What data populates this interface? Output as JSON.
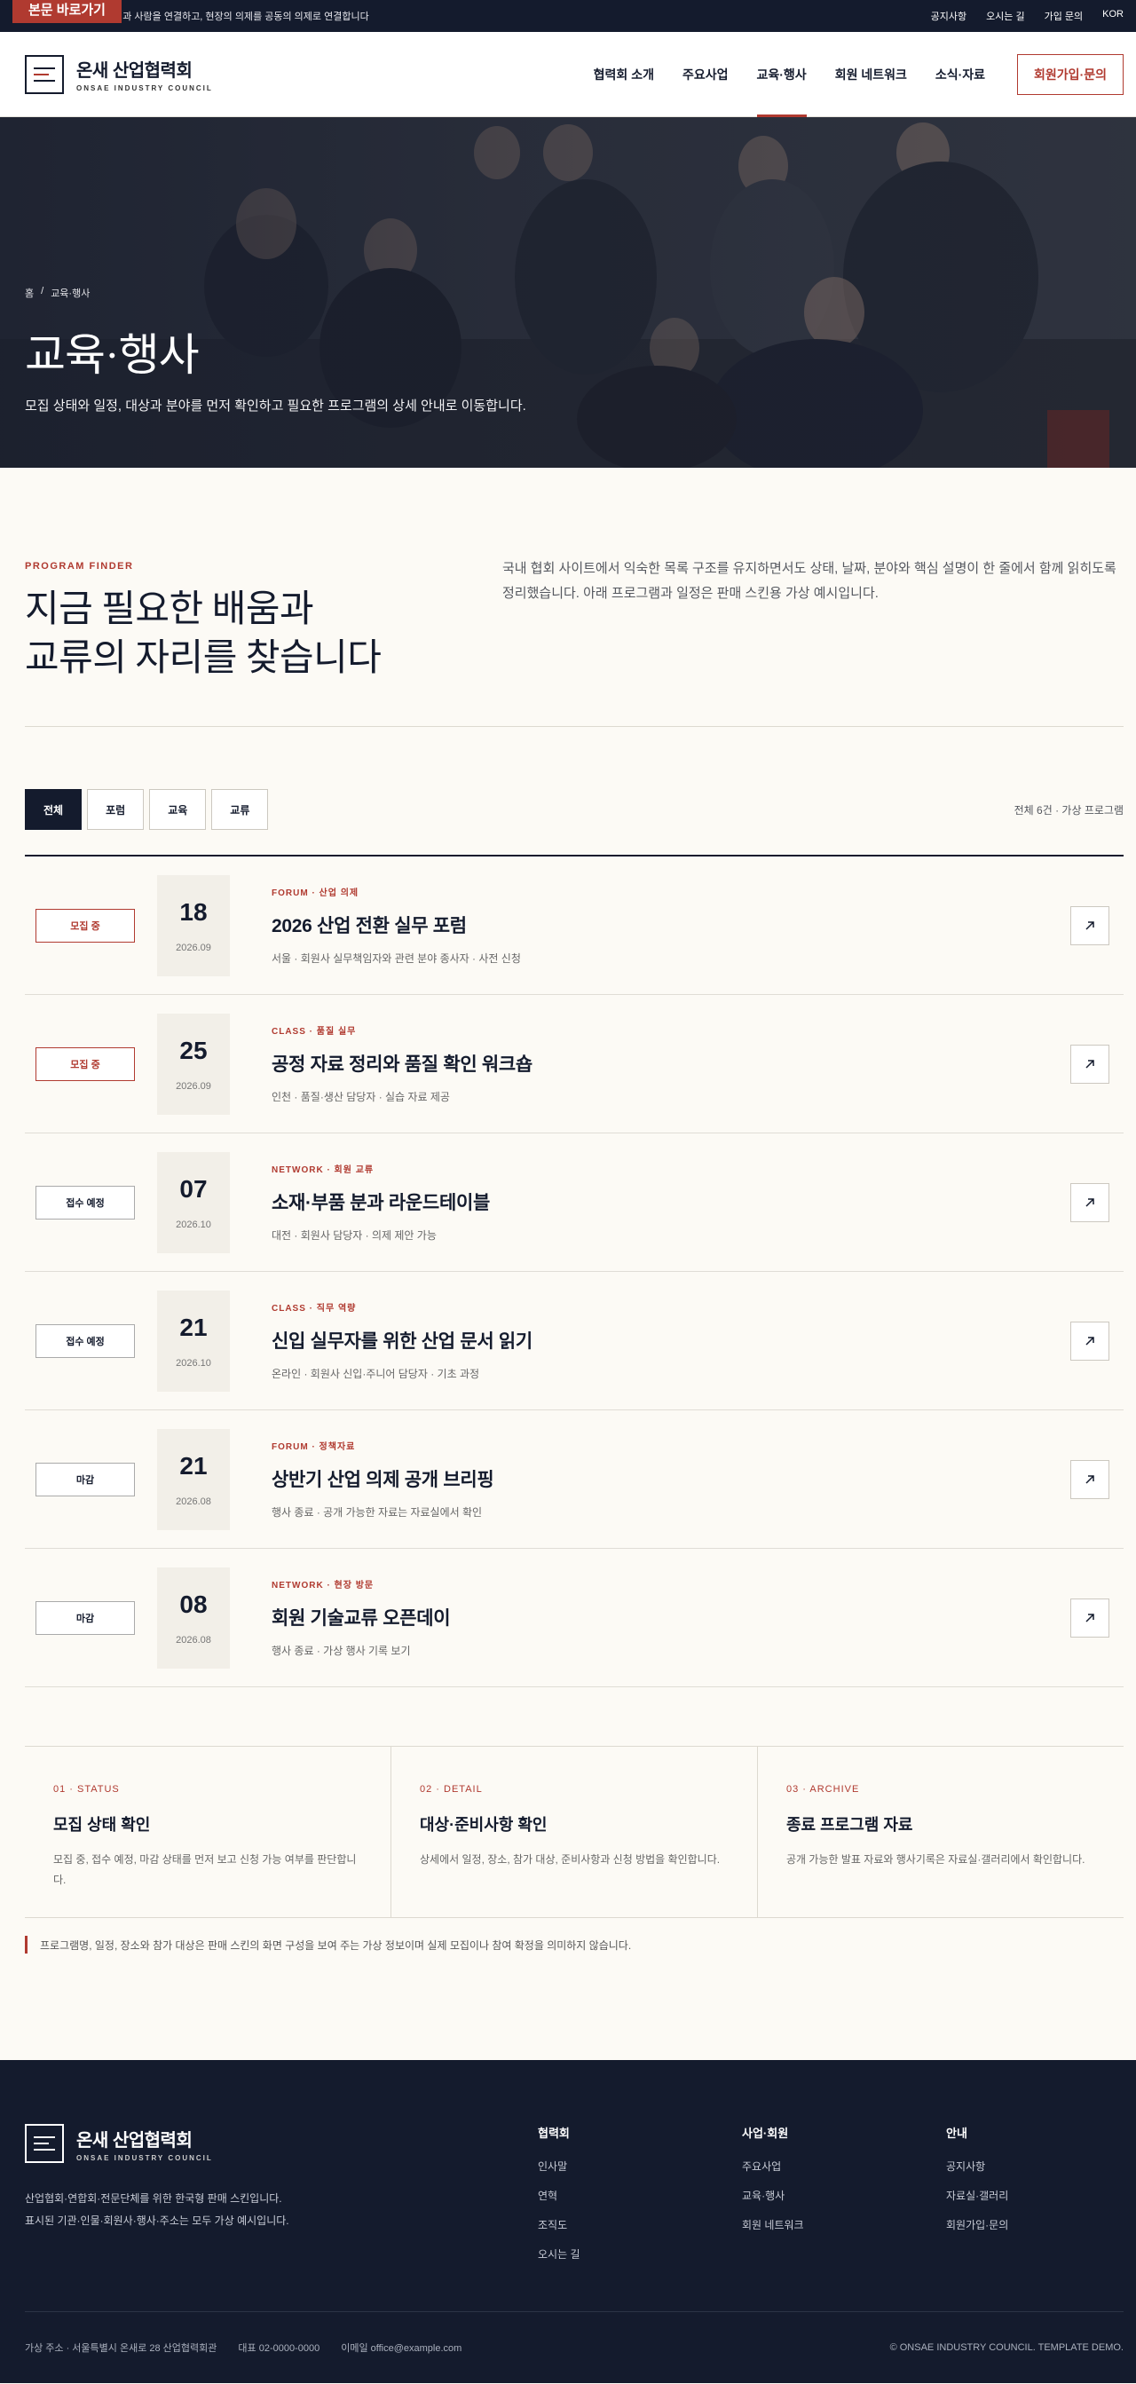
{
  "topbar": {
    "skip_label": "본문 바로가기",
    "tagline": "산업과 사람을 연결하고, 현장의 의제를 공동의 의제로 연결합니다",
    "util": [
      "공지사항",
      "오시는 길",
      "가입 문의",
      "KOR"
    ]
  },
  "header": {
    "logo_ko": "온새 산업협력회",
    "logo_en": "ONSAE INDUSTRY COUNCIL",
    "nav": [
      "협력회 소개",
      "주요사업",
      "교육·행사",
      "회원 네트워크",
      "소식·자료"
    ],
    "active_nav": "교육·행사",
    "cta": "회원가입·문의"
  },
  "hero": {
    "breadcrumb": [
      "홈",
      "/",
      "교육·행사"
    ],
    "title": "교육·행사",
    "subtitle": "모집 상태와 일정, 대상과 분야를 먼저 확인하고 필요한 프로그램의 상세 안내로 이동합니다."
  },
  "intro": {
    "eyebrow": "PROGRAM FINDER",
    "title_line1": "지금 필요한 배움과",
    "title_line2": "교류의 자리를 찾습니다",
    "desc": "국내 협회 사이트에서 익숙한 목록 구조를 유지하면서도 상태, 날짜, 분야와 핵심 설명이 한 줄에서 함께 읽히도록 정리했습니다. 아래 프로그램과 일정은 판매 스킨용 가상 예시입니다."
  },
  "filters": {
    "tabs": [
      "전체",
      "포럼",
      "교육",
      "교류"
    ],
    "active": "전체",
    "count": "전체 6건 · 가상 프로그램"
  },
  "programs": [
    {
      "status": "모집 중",
      "status_type": "open",
      "day": "18",
      "ym": "2026.09",
      "cat": "FORUM · 산업 의제",
      "title": "2026 산업 전환 실무 포럼",
      "meta": "서울 · 회원사 실무책임자와 관련 분야 종사자 · 사전 신청"
    },
    {
      "status": "모집 중",
      "status_type": "open",
      "day": "25",
      "ym": "2026.09",
      "cat": "CLASS · 품질 실무",
      "title": "공정 자료 정리와 품질 확인 워크숍",
      "meta": "인천 · 품질·생산 담당자 · 실습 자료 제공"
    },
    {
      "status": "접수 예정",
      "status_type": "soon",
      "day": "07",
      "ym": "2026.10",
      "cat": "NETWORK · 회원 교류",
      "title": "소재·부품 분과 라운드테이블",
      "meta": "대전 · 회원사 담당자 · 의제 제안 가능"
    },
    {
      "status": "접수 예정",
      "status_type": "soon",
      "day": "21",
      "ym": "2026.10",
      "cat": "CLASS · 직무 역량",
      "title": "신입 실무자를 위한 산업 문서 읽기",
      "meta": "온라인 · 회원사 신입·주니어 담당자 · 기초 과정"
    },
    {
      "status": "마감",
      "status_type": "closed",
      "day": "21",
      "ym": "2026.08",
      "cat": "FORUM · 정책자료",
      "title": "상반기 산업 의제 공개 브리핑",
      "meta": "행사 종료 · 공개 가능한 자료는 자료실에서 확인"
    },
    {
      "status": "마감",
      "status_type": "closed",
      "day": "08",
      "ym": "2026.08",
      "cat": "NETWORK · 현장 방문",
      "title": "회원 기술교류 오픈데이",
      "meta": "행사 종료 · 가상 행사 기록 보기"
    }
  ],
  "guide": [
    {
      "num": "01 · STATUS",
      "title": "모집 상태 확인",
      "desc": "모집 중, 접수 예정, 마감 상태를 먼저 보고 신청 가능 여부를 판단합니다."
    },
    {
      "num": "02 · DETAIL",
      "title": "대상·준비사항 확인",
      "desc": "상세에서 일정, 장소, 참가 대상, 준비사항과 신청 방법을 확인합니다."
    },
    {
      "num": "03 · ARCHIVE",
      "title": "종료 프로그램 자료",
      "desc": "공개 가능한 발표 자료와 행사기록은 자료실·갤러리에서 확인합니다."
    }
  ],
  "notice": "프로그램명, 일정, 장소와 참가 대상은 판매 스킨의 화면 구성을 보여 주는 가상 정보이며 실제 모집이나 참여 확정을 의미하지 않습니다.",
  "footer": {
    "logo_ko": "온새 산업협력회",
    "logo_en": "ONSAE INDUSTRY COUNCIL",
    "desc_line1": "산업협회·연합회·전문단체를 위한 한국형 판매 스킨입니다.",
    "desc_line2": "표시된 기관·인물·회원사·행사·주소는 모두 가상 예시입니다.",
    "cols": [
      {
        "title": "협력회",
        "items": [
          "인사말",
          "연혁",
          "조직도",
          "오시는 길"
        ]
      },
      {
        "title": "사업·회원",
        "items": [
          "주요사업",
          "교육·행사",
          "회원 네트워크"
        ]
      },
      {
        "title": "안내",
        "items": [
          "공지사항",
          "자료실·갤러리",
          "회원가입·문의"
        ]
      }
    ],
    "address": "가상 주소 · 서울특별시 온새로 28 산업협력회관",
    "phone": "대표 02-0000-0000",
    "email": "이메일 office@example.com",
    "copyright": "© ONSAE INDUSTRY COUNCIL. TEMPLATE DEMO."
  },
  "colors": {
    "navy": "#141b2d",
    "accent": "#b03a30",
    "bg": "#fcfaf5"
  }
}
